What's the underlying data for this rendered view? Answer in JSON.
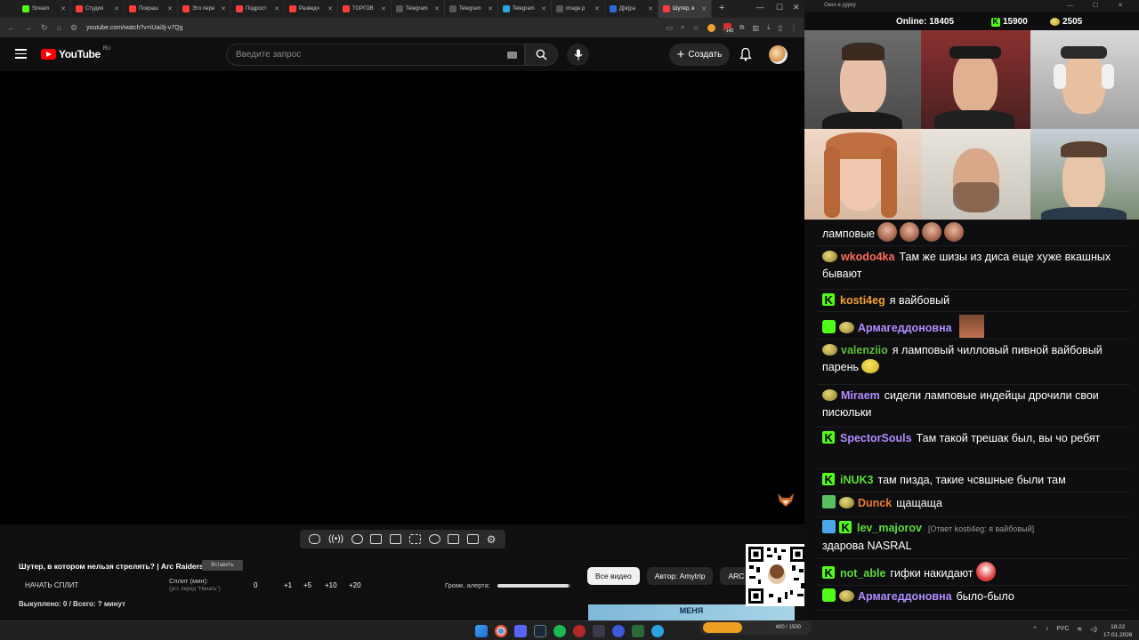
{
  "browser": {
    "tabs": [
      {
        "label": "Stream",
        "color": "#53fc18"
      },
      {
        "label": "Студия",
        "color": "#ff3b3b"
      },
      {
        "label": "Покраш",
        "color": "#ff3b3b"
      },
      {
        "label": "Это пере",
        "color": "#ff3b3b"
      },
      {
        "label": "Подрост",
        "color": "#ff3b3b"
      },
      {
        "label": "Разведч",
        "color": "#ff3b3b"
      },
      {
        "label": "ТОРГОВ",
        "color": "#ff3b3b"
      },
      {
        "label": "Telegram",
        "color": "#555555"
      },
      {
        "label": "Telegram",
        "color": "#555555"
      },
      {
        "label": "Telegram",
        "color": "#2aa3e0"
      },
      {
        "label": "image.p",
        "color": "#555555"
      },
      {
        "label": "Д[ж]ра",
        "color": "#2a6ad8"
      },
      {
        "label": "Шутер, в",
        "color": "#ff3b3b"
      }
    ],
    "url": "youtube.com/watch?v=iUai3j-v7Qg",
    "badge_count": "142"
  },
  "youtube": {
    "logo_text": "YouTube",
    "region": "RU",
    "search_placeholder": "Введите запрос",
    "create_label": "Создать"
  },
  "extension": {
    "video_title": "Шутер, в котором нельзя стрелять? | Arc Raiders",
    "title_tag": "Вставить",
    "start_split": "НАЧАТЬ СПЛИТ",
    "split_label": "Сплит (мин):",
    "split_hint": "(уст. перед \"Начать\")",
    "split_values": [
      "0",
      "+1",
      "+5",
      "+10",
      "+20"
    ],
    "volume_label": "Громк. алерта:",
    "volume_level": 0.98,
    "bought": "Выкуплено: 0 / Всего: ? минут",
    "chips": [
      "Все видео",
      "Автор: Amytrip",
      "ARC Ra"
    ],
    "banner": "МЕНЯ"
  },
  "overlay": {
    "window_title": "Окно в дурку",
    "online_label": "Online: 18405",
    "kick_count": "15900",
    "coin_count": "2505"
  },
  "chat": [
    {
      "badges": [],
      "nick": "",
      "color": "#ffffff",
      "text": "ламповые",
      "emotes": 4
    },
    {
      "badges": [
        "coin"
      ],
      "nick": "wkodo4ka",
      "color": "#ff6b5b",
      "text": "Там же шизы из диса еще хуже вкашных бывают"
    },
    {
      "badges": [
        "k"
      ],
      "nick": "kosti4eg",
      "color": "#f0a030",
      "text": "я вайбовый"
    },
    {
      "badges": [
        "sh",
        "coin"
      ],
      "nick": "Армагеддоновна",
      "color": "#b08cff",
      "text": ""
    },
    {
      "badges": [
        "coin"
      ],
      "nick": "valenziio",
      "color": "#5cbf3a",
      "text": "я ламповый чилловый пивной вайбовый парень"
    },
    {
      "badges": [
        "coin"
      ],
      "nick": "Miraem",
      "color": "#b08cff",
      "text": "сидели ламповые индейцы дрочили свои писюльки"
    },
    {
      "badges": [
        "k"
      ],
      "nick": "SpectorSouls",
      "color": "#b08cff",
      "text": "Там такой трешак был, вы чо ребят"
    },
    {
      "badges": [
        "k"
      ],
      "nick": "iNUK3",
      "color": "#5cdc3a",
      "text": "там пизда, такие чсвшные были там"
    },
    {
      "badges": [
        "pen",
        "coin"
      ],
      "nick": "Dunck",
      "color": "#f07a30",
      "text": "щащаща"
    },
    {
      "badges": [
        "sword",
        "k"
      ],
      "nick": "lev_majorov",
      "color": "#5cdc3a",
      "reply": "[Ответ kosti4eg: я вайбовый]",
      "text": "здарова NASRAL"
    },
    {
      "badges": [
        "k"
      ],
      "nick": "not_able",
      "color": "#5cdc3a",
      "text": "гифки накидают"
    },
    {
      "badges": [
        "sh",
        "coin"
      ],
      "nick": "Армагеддоновна",
      "color": "#b08cff",
      "text": "было-было"
    }
  ],
  "taskbar": {
    "lang": "РУС",
    "time": "18:22",
    "date": "17.01.2026",
    "pill_text": "400 / 1500"
  }
}
